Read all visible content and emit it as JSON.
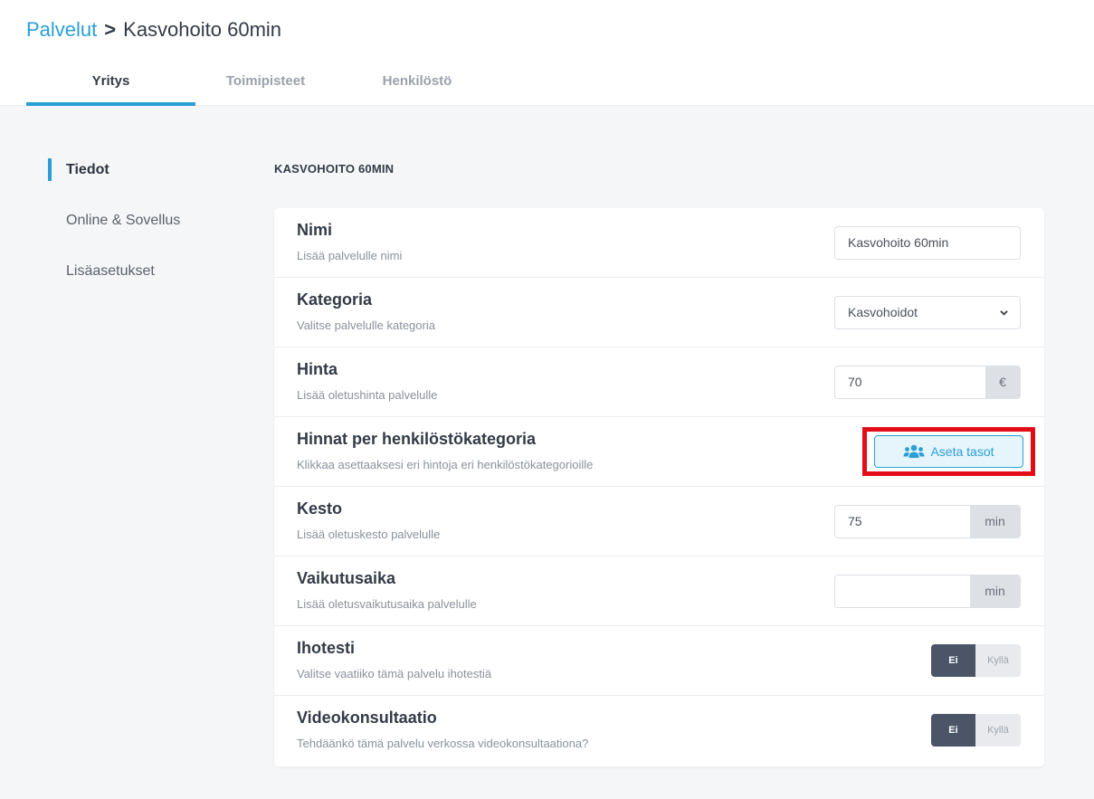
{
  "breadcrumb": {
    "parent": "Palvelut",
    "separator": ">",
    "current": "Kasvohoito 60min"
  },
  "tabs": [
    {
      "label": "Yritys",
      "active": true
    },
    {
      "label": "Toimipisteet",
      "active": false
    },
    {
      "label": "Henkilöstö",
      "active": false
    }
  ],
  "side_nav": [
    {
      "label": "Tiedot",
      "active": true
    },
    {
      "label": "Online & Sovellus",
      "active": false
    },
    {
      "label": "Lisäasetukset",
      "active": false
    }
  ],
  "section_title": "KASVOHOITO 60MIN",
  "rows": {
    "name": {
      "label": "Nimi",
      "desc": "Lisää palvelulle nimi",
      "value": "Kasvohoito 60min"
    },
    "category": {
      "label": "Kategoria",
      "desc": "Valitse palvelulle kategoria",
      "value": "Kasvohoidot"
    },
    "price": {
      "label": "Hinta",
      "desc": "Lisää oletushinta palvelulle",
      "value": "70",
      "unit": "€"
    },
    "tiers": {
      "label": "Hinnat per henkilöstökategoria",
      "desc": "Klikkaa asettaaksesi eri hintoja eri henkilöstökategorioille",
      "button": "Aseta tasot"
    },
    "duration": {
      "label": "Kesto",
      "desc": "Lisää oletuskesto palvelulle",
      "value": "75",
      "unit": "min"
    },
    "effect": {
      "label": "Vaikutusaika",
      "desc": "Lisää oletusvaikutusaika palvelulle",
      "value": "",
      "unit": "min"
    },
    "skin_test": {
      "label": "Ihotesti",
      "desc": "Valitse vaatiiko tämä palvelu ihotestiä",
      "off": "Ei",
      "on": "Kyllä"
    },
    "video": {
      "label": "Videokonsultaatio",
      "desc": "Tehdäänkö tämä palvelu verkossa videokonsultaationa?",
      "off": "Ei",
      "on": "Kyllä"
    }
  },
  "colors": {
    "accent": "#2a9fd6",
    "highlight": "#e30d17",
    "toggle_active": "#4b5567"
  }
}
